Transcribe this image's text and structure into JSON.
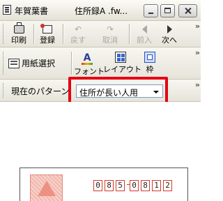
{
  "titlebar": {
    "app_title": "年賀葉書",
    "doc_title": "住所録A .fw..."
  },
  "toolbar1": {
    "print_label": "印刷",
    "register_label": "登録",
    "undo_label": "戻す",
    "cancel_label": "取消",
    "prev_label": "前入",
    "next_label": "次へ"
  },
  "toolbar2": {
    "paper_select_label": "用紙選択",
    "font_label": "フォント",
    "layout_label": "レイアウト",
    "frame_label": "枠"
  },
  "pattern": {
    "label": "現在のパターン",
    "selected_value": "住所が長い人用"
  },
  "card": {
    "postal_digits": [
      "0",
      "8",
      "5",
      "0",
      "8",
      "1",
      "2"
    ]
  },
  "colors": {
    "highlight": "#e60012",
    "postal_box": "#d43a2a"
  }
}
